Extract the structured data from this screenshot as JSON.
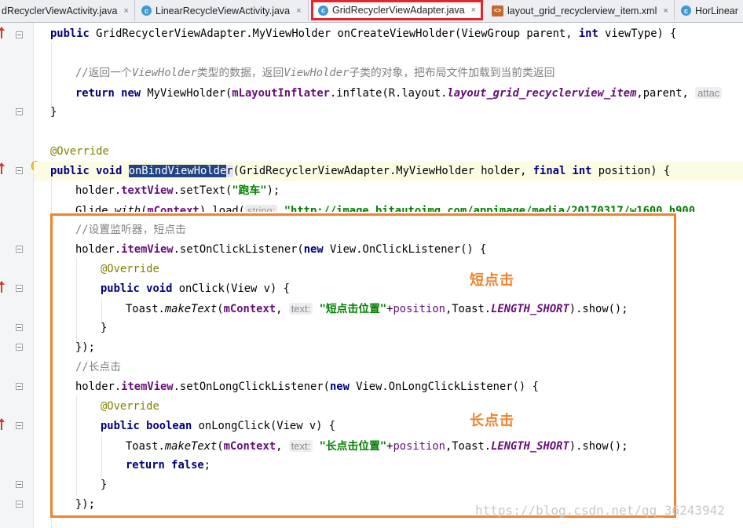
{
  "tabs": [
    {
      "label": "dRecyclerViewActivity.java",
      "icon": "java-class-icon"
    },
    {
      "label": "LinearRecycleViewActivity.java",
      "icon": "java-class-icon"
    },
    {
      "label": "GridRecyclerViewAdapter.java",
      "icon": "java-class-icon",
      "active": true
    },
    {
      "label": "layout_grid_recyclerview_item.xml",
      "icon": "xml-layout-icon"
    },
    {
      "label": "HorLinear",
      "icon": "java-class-icon"
    }
  ],
  "tab_close_glyph": "×",
  "tab_icon_letter": "c",
  "code": {
    "l1": {
      "kw1": "public ",
      "type": "GridRecyclerViewAdapter.MyViewHolder onCreateViewHolder(ViewGroup parent, ",
      "kw2": "int",
      "rest": " viewType) {"
    },
    "l2": {
      "c1": "//返回一个",
      "c2": "ViewHolder",
      "c3": "类型的数据，返回",
      "c4": "ViewHolder",
      "c5": "子类的对象，把布局文件加载到当前类返回"
    },
    "l3": {
      "kw1": "return new ",
      "t1": "MyViewHolder(",
      "fld": "mLayoutInflater",
      "t2": ".inflate(R.layout.",
      "res": "layout_grid_recyclerview_item",
      "t3": ",parent, ",
      "hint": "attac"
    },
    "l4": "}",
    "l5": "@Override",
    "l6": {
      "kw1": "public void ",
      "sel": "onBindViewHolde",
      "selrest": "r",
      "t1": "(GridRecyclerViewAdapter.MyViewHolder holder, ",
      "kw2": "final int",
      "t2": " position) {"
    },
    "l7": {
      "t1": "holder.",
      "fld": "textView",
      "t2": ".setText(",
      "str": "\"跑车\"",
      "t3": ");"
    },
    "l8": {
      "t1": "Glide.",
      "m1": "with",
      "t2": "(",
      "fld": "mContext",
      "t3": ").load(",
      "hint": "string:",
      "str": " \"http://image.bitautoimg.com/appimage/media/20170317/w1600_h900_"
    },
    "l9": "//设置监听器，短点击",
    "l10": {
      "t1": "holder.",
      "fld": "itemView",
      "t2": ".setOnClickListener(",
      "kw": "new",
      "t3": " View.OnClickListener() {"
    },
    "l11": "@Override",
    "l12": {
      "kw": "public void ",
      "t1": "onClick(View v) {"
    },
    "l13": {
      "t1": "Toast.",
      "m1": "makeText",
      "t2": "(",
      "fld": "mContext",
      "t3": ", ",
      "hint": "text:",
      "str": " \"短点击位置\"",
      "t4": "+",
      "p": "position",
      "t5": ",Toast.",
      "sf": "LENGTH_SHORT",
      "t6": ").show();"
    },
    "l14": "}",
    "l15": "});",
    "l16": "//长点击",
    "l17": {
      "t1": "holder.",
      "fld": "itemView",
      "t2": ".setOnLongClickListener(",
      "kw": "new",
      "t3": " View.OnLongClickListener() {"
    },
    "l18": "@Override",
    "l19": {
      "kw": "public boolean ",
      "t1": "onLongClick(View v) {"
    },
    "l20": {
      "t1": "Toast.",
      "m1": "makeText",
      "t2": "(",
      "fld": "mContext",
      "t3": ", ",
      "hint": "text:",
      "str": " \"长点击位置\"",
      "t4": "+",
      "p": "position",
      "t5": ",Toast.",
      "sf": "LENGTH_SHORT",
      "t6": ").show();"
    },
    "l21": {
      "kw": "return false",
      "t1": ";"
    },
    "l22": "}",
    "l23": "});"
  },
  "annotations": {
    "short_click": "短点击",
    "long_click": "长点击",
    "box_color": "#f0832d",
    "tab_highlight_color": "#e4252c"
  },
  "watermark": "https://blog.csdn.net/qq_36243942"
}
